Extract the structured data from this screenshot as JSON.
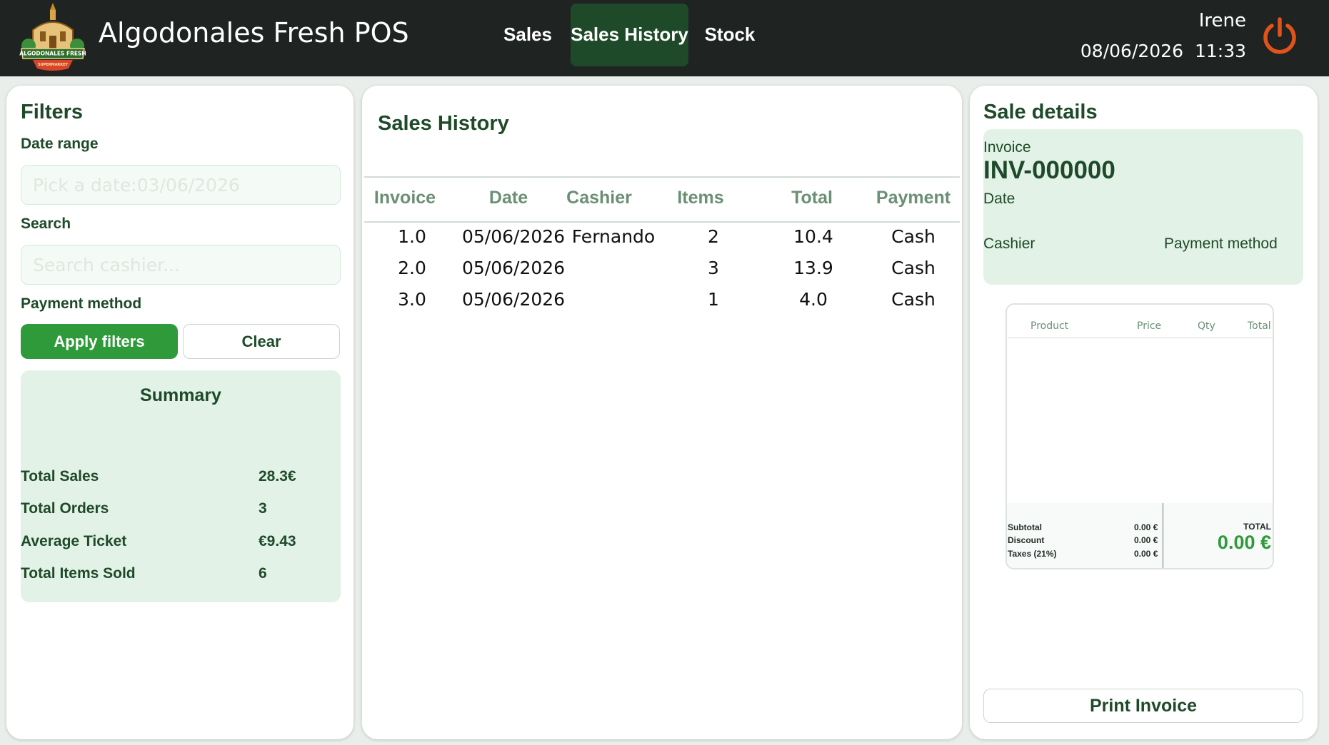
{
  "app": {
    "title": "Algodonales Fresh POS",
    "logo_text": "ALGODONALES FRESH",
    "logo_subtext": "SUPERMARKET"
  },
  "nav": {
    "tabs": [
      {
        "label": "Sales"
      },
      {
        "label": "Sales History",
        "active": true
      },
      {
        "label": "Stock"
      }
    ]
  },
  "user": {
    "name": "Irene",
    "date": "08/06/2026",
    "time": "11:33",
    "power_icon": "power-icon"
  },
  "filters": {
    "title": "Filters",
    "date_range_label": "Date range",
    "date_placeholder": "Pick a date:03/06/2026",
    "search_label": "Search",
    "search_placeholder": "Search cashier...",
    "payment_label": "Payment method",
    "apply_label": "Apply filters",
    "clear_label": "Clear"
  },
  "summary": {
    "title": "Summary",
    "rows": [
      {
        "label": "Total Sales",
        "value": "28.3€"
      },
      {
        "label": "Total Orders",
        "value": "3"
      },
      {
        "label": "Average Ticket",
        "value": "€9.43"
      },
      {
        "label": "Total Items Sold",
        "value": "6"
      }
    ]
  },
  "history": {
    "title": "Sales History",
    "columns": [
      "Invoice",
      "Date",
      "Cashier",
      "Items",
      "Total",
      "Payment"
    ],
    "rows": [
      {
        "invoice": "1.0",
        "date": "05/06/2026",
        "cashier": "Fernando",
        "items": "2",
        "total": "10.4",
        "payment": "Cash"
      },
      {
        "invoice": "2.0",
        "date": "05/06/2026",
        "cashier": "",
        "items": "3",
        "total": "13.9",
        "payment": "Cash"
      },
      {
        "invoice": "3.0",
        "date": "05/06/2026",
        "cashier": "",
        "items": "1",
        "total": "4.0",
        "payment": "Cash"
      }
    ]
  },
  "details": {
    "title": "Sale details",
    "invoice_label": "Invoice",
    "invoice_number": "INV-000000",
    "date_label": "Date",
    "cashier_label": "Cashier",
    "payment_label": "Payment method",
    "receipt": {
      "columns": [
        "Product",
        "Price",
        "Qty",
        "Total"
      ],
      "subtotal_label": "Subtotal",
      "subtotal": "0.00 €",
      "discount_label": "Discount",
      "discount": "0.00 €",
      "taxes_label": "Taxes (21%)",
      "taxes": "0.00 €",
      "total_label": "TOTAL",
      "total": "0.00 €"
    },
    "print_label": "Print Invoice"
  },
  "colors": {
    "accent": "#2e9a3a",
    "dark": "#1f2321",
    "brand_text": "#1f4a2a",
    "soft_green": "#e3f2e7",
    "power": "#e2531c"
  }
}
